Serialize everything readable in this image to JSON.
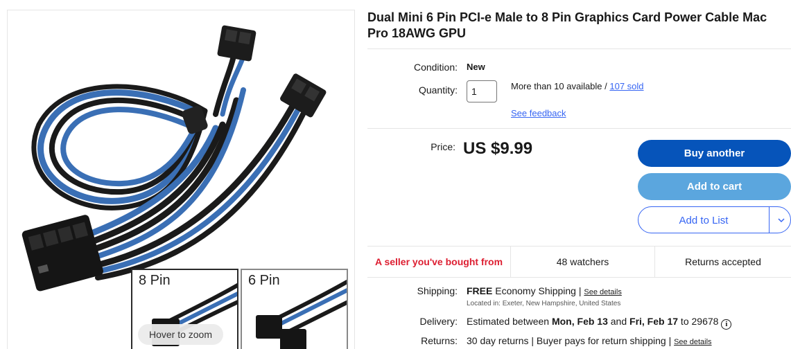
{
  "product": {
    "title": "Dual Mini 6 Pin PCI-e Male to 8 Pin Graphics Card Power Cable Mac Pro 18AWG GPU",
    "image": {
      "thumb_labels": [
        "8 Pin",
        "6 Pin"
      ],
      "zoom_hint": "Hover to zoom",
      "cable_colors": [
        "#3a6fb5",
        "#1a1a1a"
      ]
    }
  },
  "details": {
    "condition_label": "Condition:",
    "condition_value": "New",
    "quantity_label": "Quantity:",
    "quantity_value": "1",
    "availability_text": "More than 10 available / ",
    "sold_link": "107 sold",
    "feedback_link": "See feedback"
  },
  "price": {
    "label": "Price:",
    "value": "US $9.99"
  },
  "buttons": {
    "buy": "Buy another",
    "cart": "Add to cart",
    "list": "Add to List"
  },
  "stats": {
    "seller": "A seller you've bought from",
    "watchers": "48 watchers",
    "returns": "Returns accepted"
  },
  "shipping": {
    "label": "Shipping:",
    "free": "FREE",
    "method": " Economy Shipping | ",
    "details_link": "See details",
    "location": "Located in: Exeter, New Hampshire, United States"
  },
  "delivery": {
    "label": "Delivery:",
    "prefix": "Estimated between ",
    "date_start": "Mon, Feb 13",
    "and": " and ",
    "date_end": "Fri, Feb 17",
    "to": " to 29678"
  },
  "returns": {
    "label": "Returns:",
    "text": "30 day returns | Buyer pays for return shipping | ",
    "details_link": "See details"
  },
  "colors": {
    "primary_button": "#0654ba",
    "secondary_button": "#5ba6de",
    "link": "#3665f3",
    "seller_text": "#dd1e31"
  }
}
